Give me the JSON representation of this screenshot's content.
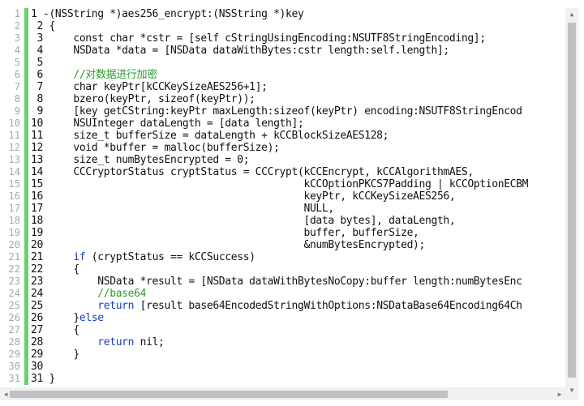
{
  "editor": {
    "lines": [
      {
        "n": "1",
        "num": "1",
        "code": " -(NSString *)aes256_encrypt:(NSString *)key"
      },
      {
        "n": "2",
        "num": " 2",
        "code": " {"
      },
      {
        "n": "3",
        "num": " 3",
        "code": "     const char *cstr = [self cStringUsingEncoding:NSUTF8StringEncoding];"
      },
      {
        "n": "4",
        "num": " 4",
        "code": "     NSData *data = [NSData dataWithBytes:cstr length:self.length];"
      },
      {
        "n": "5",
        "num": " 5",
        "code": ""
      },
      {
        "n": "6",
        "num": " 6",
        "code": "     //对数据进行加密",
        "comment": true
      },
      {
        "n": "7",
        "num": " 7",
        "code": "     char keyPtr[kCCKeySizeAES256+1];"
      },
      {
        "n": "8",
        "num": " 8",
        "code": "     bzero(keyPtr, sizeof(keyPtr));"
      },
      {
        "n": "9",
        "num": " 9",
        "code": "     [key getCString:keyPtr maxLength:sizeof(keyPtr) encoding:NSUTF8StringEncod"
      },
      {
        "n": "10",
        "num": "10",
        "code": "     NSUInteger dataLength = [data length];"
      },
      {
        "n": "11",
        "num": "11",
        "code": "     size_t bufferSize = dataLength + kCCBlockSizeAES128;"
      },
      {
        "n": "12",
        "num": "12",
        "code": "     void *buffer = malloc(bufferSize);"
      },
      {
        "n": "13",
        "num": "13",
        "code": "     size_t numBytesEncrypted = 0;"
      },
      {
        "n": "14",
        "num": "14",
        "code": "     CCCryptorStatus cryptStatus = CCCrypt(kCCEncrypt, kCCAlgorithmAES,"
      },
      {
        "n": "15",
        "num": "15",
        "code": "                                           kCCOptionPKCS7Padding | kCCOptionECBM"
      },
      {
        "n": "16",
        "num": "16",
        "code": "                                           keyPtr, kCCKeySizeAES256,"
      },
      {
        "n": "17",
        "num": "17",
        "code": "                                           NULL,"
      },
      {
        "n": "18",
        "num": "18",
        "code": "                                           [data bytes], dataLength,"
      },
      {
        "n": "19",
        "num": "19",
        "code": "                                           buffer, bufferSize,"
      },
      {
        "n": "20",
        "num": "20",
        "code": "                                           &numBytesEncrypted);"
      },
      {
        "n": "21",
        "num": "21",
        "code": "     if (cryptStatus == kCCSuccess)"
      },
      {
        "n": "22",
        "num": "22",
        "code": "     {"
      },
      {
        "n": "23",
        "num": "23",
        "code": "         NSData *result = [NSData dataWithBytesNoCopy:buffer length:numBytesEnc"
      },
      {
        "n": "24",
        "num": "24",
        "code": "         //base64",
        "comment": true
      },
      {
        "n": "25",
        "num": "25",
        "code": "         return [result base64EncodedStringWithOptions:NSDataBase64Encoding64Ch"
      },
      {
        "n": "26",
        "num": "26",
        "code": "     }else"
      },
      {
        "n": "27",
        "num": "27",
        "code": "     {"
      },
      {
        "n": "28",
        "num": "28",
        "code": "         return nil;"
      },
      {
        "n": "29",
        "num": "29",
        "code": "     }"
      },
      {
        "n": "30",
        "num": "30",
        "code": ""
      },
      {
        "n": "31",
        "num": "31",
        "code": " }"
      }
    ]
  },
  "scroll": {
    "up_arrow": "▲",
    "down_arrow": "▼",
    "left_arrow": "◀",
    "right_arrow": "▶"
  },
  "colors": {
    "change_bar": "#6ccf6c",
    "comment": "#2b9a2b",
    "keyword": "#1a3fc0",
    "line_number": "#a8a8a8"
  }
}
